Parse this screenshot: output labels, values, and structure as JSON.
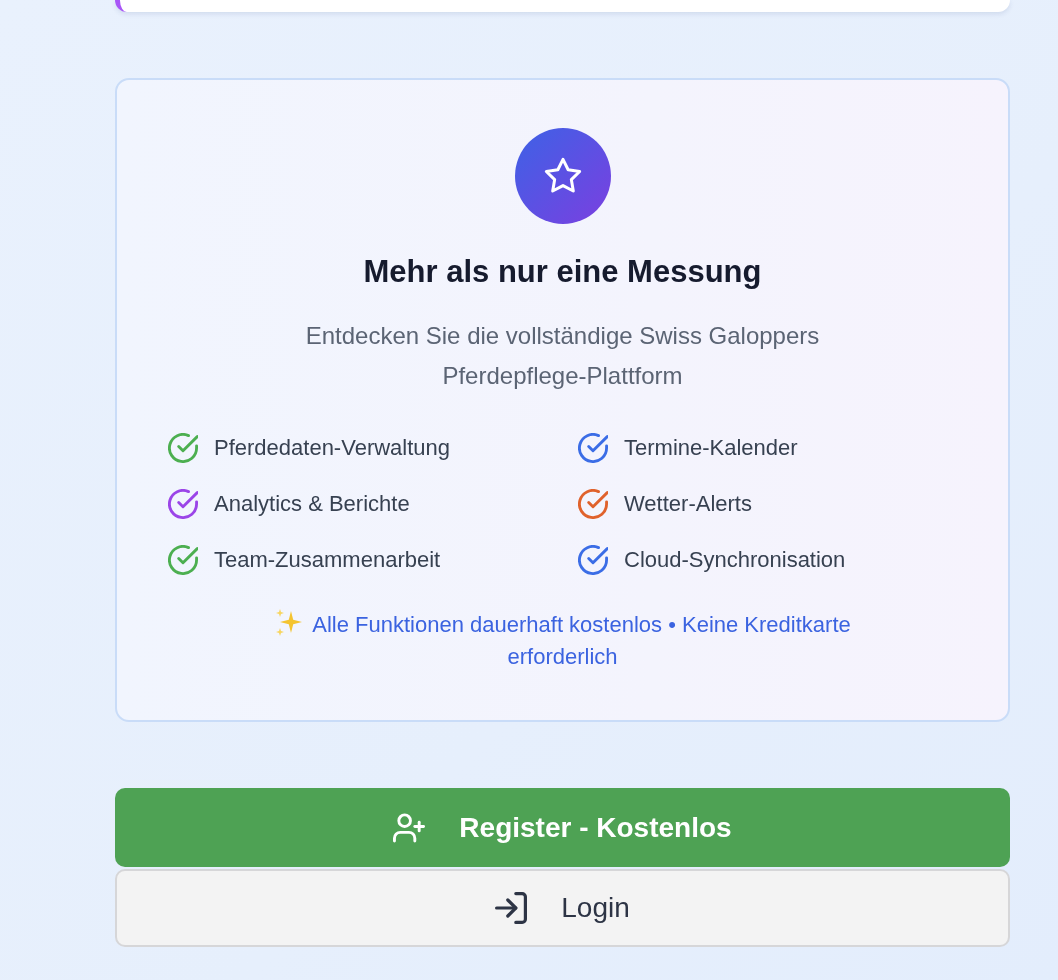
{
  "feature_card": {
    "title": "Mehr als nur eine Messung",
    "subtitle": "Entdecken Sie die vollständige Swiss Galoppers Pferdepflege-Plattform",
    "features": [
      {
        "label": "Pferdedaten-Verwaltung",
        "color": "#4caf50"
      },
      {
        "label": "Termine-Kalender",
        "color": "#3b6de6"
      },
      {
        "label": "Analytics & Berichte",
        "color": "#9b45e8"
      },
      {
        "label": "Wetter-Alerts",
        "color": "#e0622c"
      },
      {
        "label": "Team-Zusammenarbeit",
        "color": "#4caf50"
      },
      {
        "label": "Cloud-Synchronisation",
        "color": "#3b6de6"
      }
    ],
    "note": "Alle Funktionen dauerhaft kostenlos • Keine Kreditkarte erforderlich"
  },
  "actions": [
    {
      "kind": "register",
      "label": "Register - Kostenlos"
    },
    {
      "kind": "login",
      "label": "Login"
    }
  ]
}
